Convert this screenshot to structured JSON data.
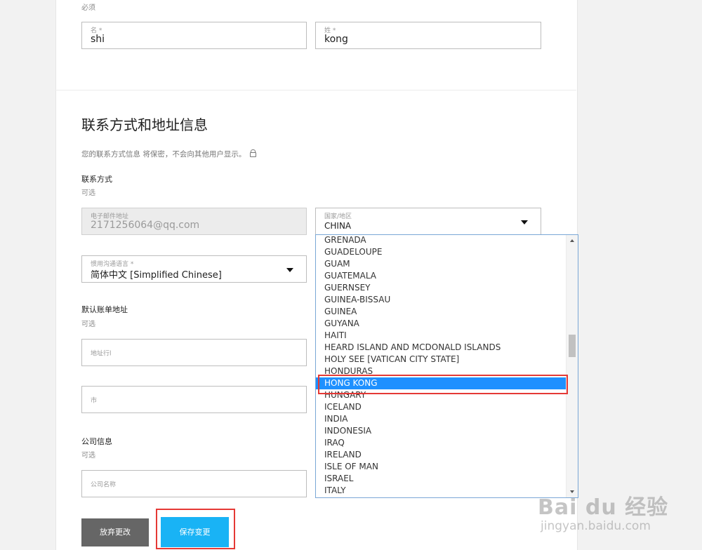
{
  "top": {
    "required_note": "必须",
    "first_name": {
      "label": "名 *",
      "value": "shi"
    },
    "last_name": {
      "label": "姓 *",
      "value": "kong"
    }
  },
  "contact_section": {
    "title": "联系方式和地址信息",
    "privacy_note": "您的联系方式信息 将保密，不会向其他用户显示。",
    "contact_label": "联系方式",
    "contact_optional": "可选",
    "email": {
      "label": "电子邮件地址",
      "value": "2171256064@qq.com"
    },
    "country": {
      "label": "国家/地区",
      "value": "CHINA"
    },
    "language": {
      "label": "惯用沟通语言 *",
      "value": "简体中文 [Simplified Chinese]"
    },
    "billing_label": "默认账单地址",
    "billing_optional": "可选",
    "address_line_placeholder": "地址行l",
    "city_placeholder": "市",
    "company_label": "公司信息",
    "company_optional": "可选",
    "company_placeholder": "公司名称"
  },
  "dropdown": {
    "items": [
      "GRENADA",
      "GUADELOUPE",
      "GUAM",
      "GUATEMALA",
      "GUERNSEY",
      "GUINEA-BISSAU",
      "GUINEA",
      "GUYANA",
      "HAITI",
      "HEARD ISLAND AND MCDONALD ISLANDS",
      "HOLY SEE [VATICAN CITY STATE]",
      "HONDURAS",
      "HONG KONG",
      "HUNGARY",
      "ICELAND",
      "INDIA",
      "INDONESIA",
      "IRAQ",
      "IRELAND",
      "ISLE OF MAN",
      "ISRAEL",
      "ITALY"
    ],
    "selected": "HONG KONG"
  },
  "buttons": {
    "cancel": "放弃更改",
    "save": "保存变更"
  },
  "watermark": {
    "brand": "Bai du 经验",
    "url": "jingyan.baidu.com"
  },
  "colors": {
    "accent": "#19b3f5",
    "highlight": "#e53935",
    "selected_item": "#1e90ff"
  }
}
